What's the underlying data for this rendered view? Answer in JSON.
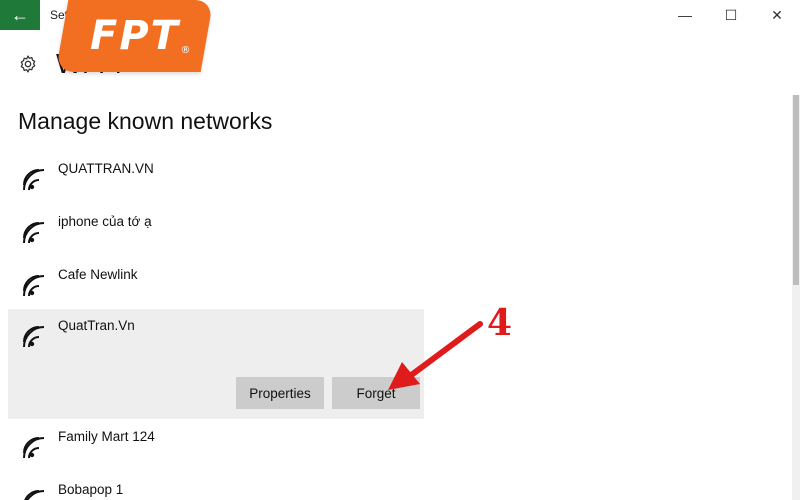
{
  "window": {
    "back_icon": "←",
    "title": "Settin",
    "minimize_icon": "—",
    "maximize_icon": "☐",
    "close_icon": "✕"
  },
  "logo": {
    "text": "FPT",
    "registered": "®",
    "color": "#f26f21"
  },
  "header": {
    "icon": "gear-icon",
    "title": "Wi-Fi"
  },
  "section": {
    "title": "Manage known networks"
  },
  "networks": [
    {
      "name": "QUATTRAN.VN"
    },
    {
      "name": "iphone của tớ ạ"
    },
    {
      "name": "Cafe Newlink"
    },
    {
      "name": "QuatTran.Vn",
      "selected": true
    },
    {
      "name": "Family Mart 124"
    },
    {
      "name": "Bobapop 1"
    }
  ],
  "actions": {
    "properties_label": "Properties",
    "forget_label": "Forget"
  },
  "annotation": {
    "step": "4",
    "color": "#e01b1b"
  },
  "colors": {
    "back_button": "#1f7a3a",
    "selected_row": "#eeeeee",
    "button": "#cccccc"
  }
}
